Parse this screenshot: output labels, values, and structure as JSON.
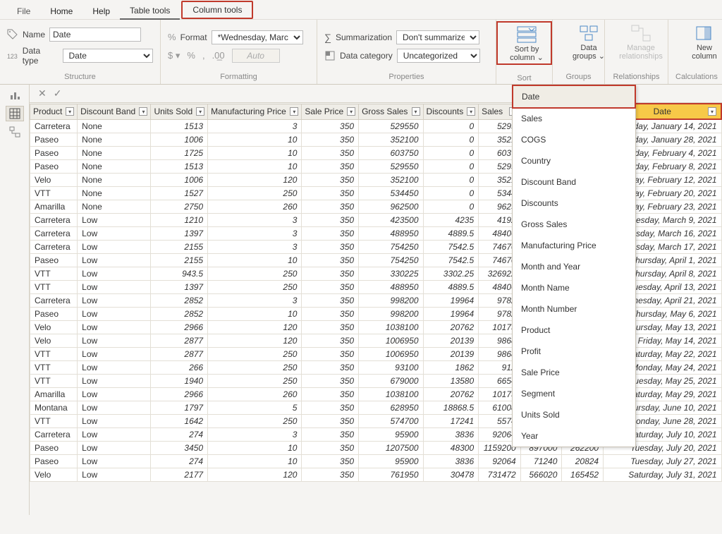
{
  "menu": {
    "file": "File",
    "home": "Home",
    "help": "Help",
    "table_tools": "Table tools",
    "column_tools": "Column tools"
  },
  "ribbon": {
    "name_label": "Name",
    "name_value": "Date",
    "datatype_label": "Data type",
    "datatype_value": "Date",
    "format_label": "Format",
    "format_value": "*Wednesday, Marc…",
    "auto": "Auto",
    "summarization_label": "Summarization",
    "summarization_value": "Don't summarize",
    "datacategory_label": "Data category",
    "datacategory_value": "Uncategorized",
    "sortby": "Sort by",
    "sortby2": "column",
    "chev": "⌄",
    "datagroups": "Data",
    "datagroups2": "groups",
    "manage": "Manage",
    "manage2": "relationships",
    "newcol": "New",
    "newcol2": "column",
    "grp_structure": "Structure",
    "grp_formatting": "Formatting",
    "grp_properties": "Properties",
    "grp_sort": "Sort",
    "grp_groups": "Groups",
    "grp_rel": "Relationships",
    "grp_calc": "Calculations"
  },
  "columns": [
    "Product",
    "Discount Band",
    "Units Sold",
    "Manufacturing Price",
    "Sale Price",
    "Gross Sales",
    "Discounts",
    "Sales"
  ],
  "date_col": "Date",
  "dropdown_items": [
    "Date",
    "Sales",
    "COGS",
    "Country",
    "Discount Band",
    "Discounts",
    "Gross Sales",
    "Manufacturing Price",
    "Month and Year",
    "Month Name",
    "Month Number",
    "Product",
    "Profit",
    "Sale Price",
    "Segment",
    "Units Sold",
    "Year"
  ],
  "rows": [
    {
      "p": "Carretera",
      "d": "None",
      "u": "1513",
      "mp": "3",
      "sp": "350",
      "gs": "529550",
      "disc": "0",
      "sales": "5295",
      "c9": "",
      "c10": "",
      "date": "Thursday, January 14, 2021"
    },
    {
      "p": "Paseo",
      "d": "None",
      "u": "1006",
      "mp": "10",
      "sp": "350",
      "gs": "352100",
      "disc": "0",
      "sales": "3521",
      "c9": "",
      "c10": "",
      "date": "Thursday, January 28, 2021"
    },
    {
      "p": "Paseo",
      "d": "None",
      "u": "1725",
      "mp": "10",
      "sp": "350",
      "gs": "603750",
      "disc": "0",
      "sales": "6037",
      "c9": "",
      "c10": "",
      "date": "Thursday, February 4, 2021"
    },
    {
      "p": "Paseo",
      "d": "None",
      "u": "1513",
      "mp": "10",
      "sp": "350",
      "gs": "529550",
      "disc": "0",
      "sales": "5295",
      "c9": "",
      "c10": "",
      "date": "Monday, February 8, 2021"
    },
    {
      "p": "Velo",
      "d": "None",
      "u": "1006",
      "mp": "120",
      "sp": "350",
      "gs": "352100",
      "disc": "0",
      "sales": "3521",
      "c9": "",
      "c10": "",
      "date": "Friday, February 12, 2021"
    },
    {
      "p": "VTT",
      "d": "None",
      "u": "1527",
      "mp": "250",
      "sp": "350",
      "gs": "534450",
      "disc": "0",
      "sales": "5344",
      "c9": "",
      "c10": "",
      "date": "Saturday, February 20, 2021"
    },
    {
      "p": "Amarilla",
      "d": "None",
      "u": "2750",
      "mp": "260",
      "sp": "350",
      "gs": "962500",
      "disc": "0",
      "sales": "9625",
      "c9": "",
      "c10": "",
      "date": "Tuesday, February 23, 2021"
    },
    {
      "p": "Carretera",
      "d": "Low",
      "u": "1210",
      "mp": "3",
      "sp": "350",
      "gs": "423500",
      "disc": "4235",
      "sales": "4192",
      "c9": "",
      "c10": "",
      "date": "Tuesday, March 9, 2021"
    },
    {
      "p": "Carretera",
      "d": "Low",
      "u": "1397",
      "mp": "3",
      "sp": "350",
      "gs": "488950",
      "disc": "4889.5",
      "sales": "48406",
      "c9": "",
      "c10": "",
      "date": "Tuesday, March 16, 2021"
    },
    {
      "p": "Carretera",
      "d": "Low",
      "u": "2155",
      "mp": "3",
      "sp": "350",
      "gs": "754250",
      "disc": "7542.5",
      "sales": "74670",
      "c9": "",
      "c10": "",
      "date": "Wednesday, March 17, 2021"
    },
    {
      "p": "Paseo",
      "d": "Low",
      "u": "2155",
      "mp": "10",
      "sp": "350",
      "gs": "754250",
      "disc": "7542.5",
      "sales": "74670",
      "c9": "",
      "c10": "",
      "date": "Thursday, April 1, 2021"
    },
    {
      "p": "VTT",
      "d": "Low",
      "u": "943.5",
      "mp": "250",
      "sp": "350",
      "gs": "330225",
      "disc": "3302.25",
      "sales": "326922",
      "c9": "",
      "c10": "",
      "date": "Thursday, April 8, 2021"
    },
    {
      "p": "VTT",
      "d": "Low",
      "u": "1397",
      "mp": "250",
      "sp": "350",
      "gs": "488950",
      "disc": "4889.5",
      "sales": "48406",
      "c9": "",
      "c10": "",
      "date": "Tuesday, April 13, 2021"
    },
    {
      "p": "Carretera",
      "d": "Low",
      "u": "2852",
      "mp": "3",
      "sp": "350",
      "gs": "998200",
      "disc": "19964",
      "sales": "9782",
      "c9": "",
      "c10": "",
      "date": "Wednesday, April 21, 2021"
    },
    {
      "p": "Paseo",
      "d": "Low",
      "u": "2852",
      "mp": "10",
      "sp": "350",
      "gs": "998200",
      "disc": "19964",
      "sales": "9782",
      "c9": "",
      "c10": "",
      "date": "Thursday, May 6, 2021"
    },
    {
      "p": "Velo",
      "d": "Low",
      "u": "2966",
      "mp": "120",
      "sp": "350",
      "gs": "1038100",
      "disc": "20762",
      "sales": "10173",
      "c9": "",
      "c10": "",
      "date": "Thursday, May 13, 2021"
    },
    {
      "p": "Velo",
      "d": "Low",
      "u": "2877",
      "mp": "120",
      "sp": "350",
      "gs": "1006950",
      "disc": "20139",
      "sales": "9868",
      "c9": "",
      "c10": "",
      "date": "Friday, May 14, 2021"
    },
    {
      "p": "VTT",
      "d": "Low",
      "u": "2877",
      "mp": "250",
      "sp": "350",
      "gs": "1006950",
      "disc": "20139",
      "sales": "9868",
      "c9": "",
      "c10": "",
      "date": "Saturday, May 22, 2021"
    },
    {
      "p": "VTT",
      "d": "Low",
      "u": "266",
      "mp": "250",
      "sp": "350",
      "gs": "93100",
      "disc": "1862",
      "sales": "912",
      "c9": "",
      "c10": "",
      "date": "Monday, May 24, 2021"
    },
    {
      "p": "VTT",
      "d": "Low",
      "u": "1940",
      "mp": "250",
      "sp": "350",
      "gs": "679000",
      "disc": "13580",
      "sales": "6654",
      "c9": "",
      "c10": "",
      "date": "Tuesday, May 25, 2021"
    },
    {
      "p": "Amarilla",
      "d": "Low",
      "u": "2966",
      "mp": "260",
      "sp": "350",
      "gs": "1038100",
      "disc": "20762",
      "sales": "10173",
      "c9": "",
      "c10": "",
      "date": "Saturday, May 29, 2021"
    },
    {
      "p": "Montana",
      "d": "Low",
      "u": "1797",
      "mp": "5",
      "sp": "350",
      "gs": "628950",
      "disc": "18868.5",
      "sales": "61008",
      "c9": "",
      "c10": "",
      "date": "Thursday, June 10, 2021"
    },
    {
      "p": "VTT",
      "d": "Low",
      "u": "1642",
      "mp": "250",
      "sp": "350",
      "gs": "574700",
      "disc": "17241",
      "sales": "5574",
      "c9": "",
      "c10": "",
      "date": "Monday, June 28, 2021"
    },
    {
      "p": "Carretera",
      "d": "Low",
      "u": "274",
      "mp": "3",
      "sp": "350",
      "gs": "95900",
      "disc": "3836",
      "sales": "92064",
      "c9": "71240",
      "c10": "20824",
      "date": "Saturday, July 10, 2021"
    },
    {
      "p": "Paseo",
      "d": "Low",
      "u": "3450",
      "mp": "10",
      "sp": "350",
      "gs": "1207500",
      "disc": "48300",
      "sales": "1159200",
      "c9": "897000",
      "c10": "262200",
      "date": "Tuesday, July 20, 2021"
    },
    {
      "p": "Paseo",
      "d": "Low",
      "u": "274",
      "mp": "10",
      "sp": "350",
      "gs": "95900",
      "disc": "3836",
      "sales": "92064",
      "c9": "71240",
      "c10": "20824",
      "date": "Tuesday, July 27, 2021"
    },
    {
      "p": "Velo",
      "d": "Low",
      "u": "2177",
      "mp": "120",
      "sp": "350",
      "gs": "761950",
      "disc": "30478",
      "sales": "731472",
      "c9": "566020",
      "c10": "165452",
      "date": "Saturday, July 31, 2021"
    }
  ]
}
